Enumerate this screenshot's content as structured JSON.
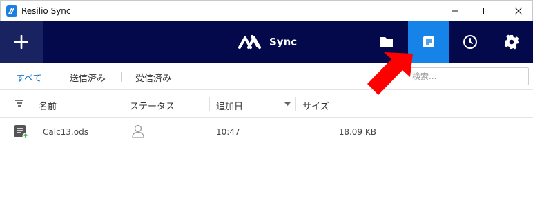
{
  "window": {
    "title": "Resilio Sync"
  },
  "header": {
    "logo_text": "Sync",
    "buttons": [
      "add-icon",
      "folder-icon",
      "transfers-icon",
      "history-icon",
      "gear-icon"
    ],
    "accent_color": "#1683e8",
    "background_color": "#03094a"
  },
  "filters": {
    "tabs": [
      {
        "label": "すべて",
        "active": true
      },
      {
        "label": "送信済み",
        "active": false
      },
      {
        "label": "受信済み",
        "active": false
      }
    ],
    "search_placeholder": "検索..."
  },
  "table": {
    "columns": [
      "名前",
      "ステータス",
      "追加日",
      "サイズ"
    ],
    "rows": [
      {
        "name": "Calc13.ods",
        "status_icon": "user-icon",
        "added": "10:47",
        "size": "18.09 KB"
      }
    ]
  },
  "annotation": {
    "color": "#ff0000",
    "target": "transfers-button"
  }
}
